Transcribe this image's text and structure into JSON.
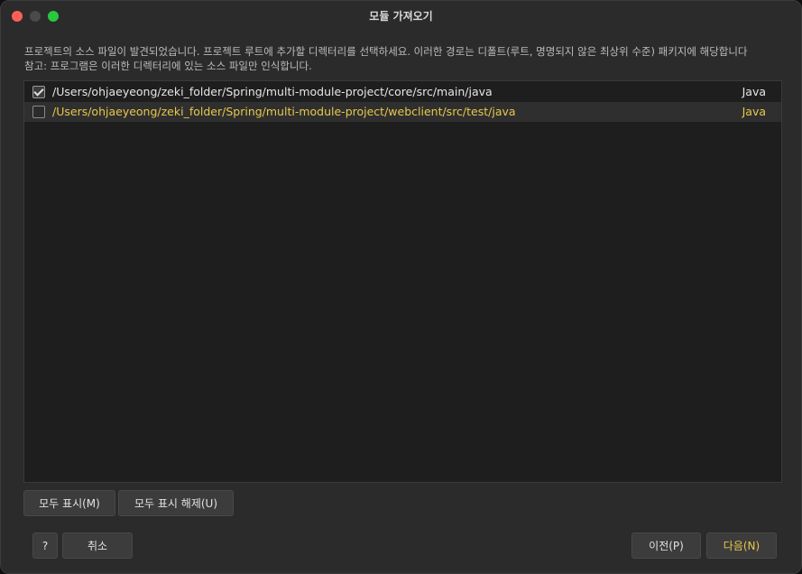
{
  "window": {
    "title": "모듈 가져오기"
  },
  "description": {
    "line1": "프로젝트의 소스 파일이 발견되었습니다. 프로젝트 루트에 추가할 디렉터리를 선택하세요. 이러한 경로는 디폴트(루트, 명명되지 않은 최상위 수준) 패키지에 해당합니다",
    "line2": "참고: 프로그램은 이러한 디렉터리에 있는 소스 파일만 인식합니다."
  },
  "source_roots": [
    {
      "checked": true,
      "path": "/Users/ohjaeyeong/zeki_folder/Spring/multi-module-project/core/src/main/java",
      "kind": "Java"
    },
    {
      "checked": false,
      "path": "/Users/ohjaeyeong/zeki_folder/Spring/multi-module-project/webclient/src/test/java",
      "kind": "Java"
    }
  ],
  "buttons": {
    "show_all": "모두 표시(M)",
    "hide_all": "모두 표시 해제(U)",
    "help": "?",
    "cancel": "취소",
    "previous": "이전(P)",
    "next": "다음(N)"
  },
  "colors": {
    "highlight_text": "#e8c84a",
    "close": "#ff5f57",
    "maximize": "#28c840"
  }
}
